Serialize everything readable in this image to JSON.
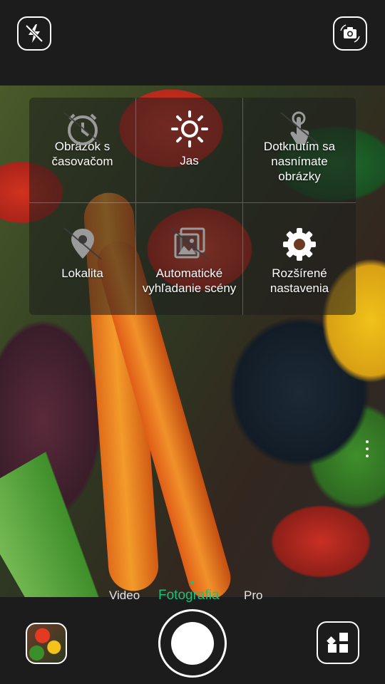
{
  "top_bar": {
    "flash_icon": "flash-off-icon",
    "switch_camera_icon": "switch-camera-icon"
  },
  "settings_panel": {
    "items": [
      {
        "label": "Obrázok s\nčasovačom",
        "icon": "timer-icon",
        "disabled": true
      },
      {
        "label": "Jas",
        "icon": "brightness-icon",
        "disabled": false
      },
      {
        "label": "Dotknutím sa\nnasnímate\nobrázky",
        "icon": "touch-capture-icon",
        "disabled": true
      },
      {
        "label": "Lokalita",
        "icon": "location-icon",
        "disabled": true
      },
      {
        "label": "Automatické\nvyhľadanie scény",
        "icon": "scene-detect-icon",
        "disabled": true
      },
      {
        "label": "Rozšírené\nnastavenia",
        "icon": "gear-icon",
        "disabled": false
      }
    ]
  },
  "modes": {
    "video": "Video",
    "photo": "Fotografia",
    "pro": "Pro",
    "selected": "Fotografia"
  },
  "colors": {
    "accent": "#19c17a"
  }
}
